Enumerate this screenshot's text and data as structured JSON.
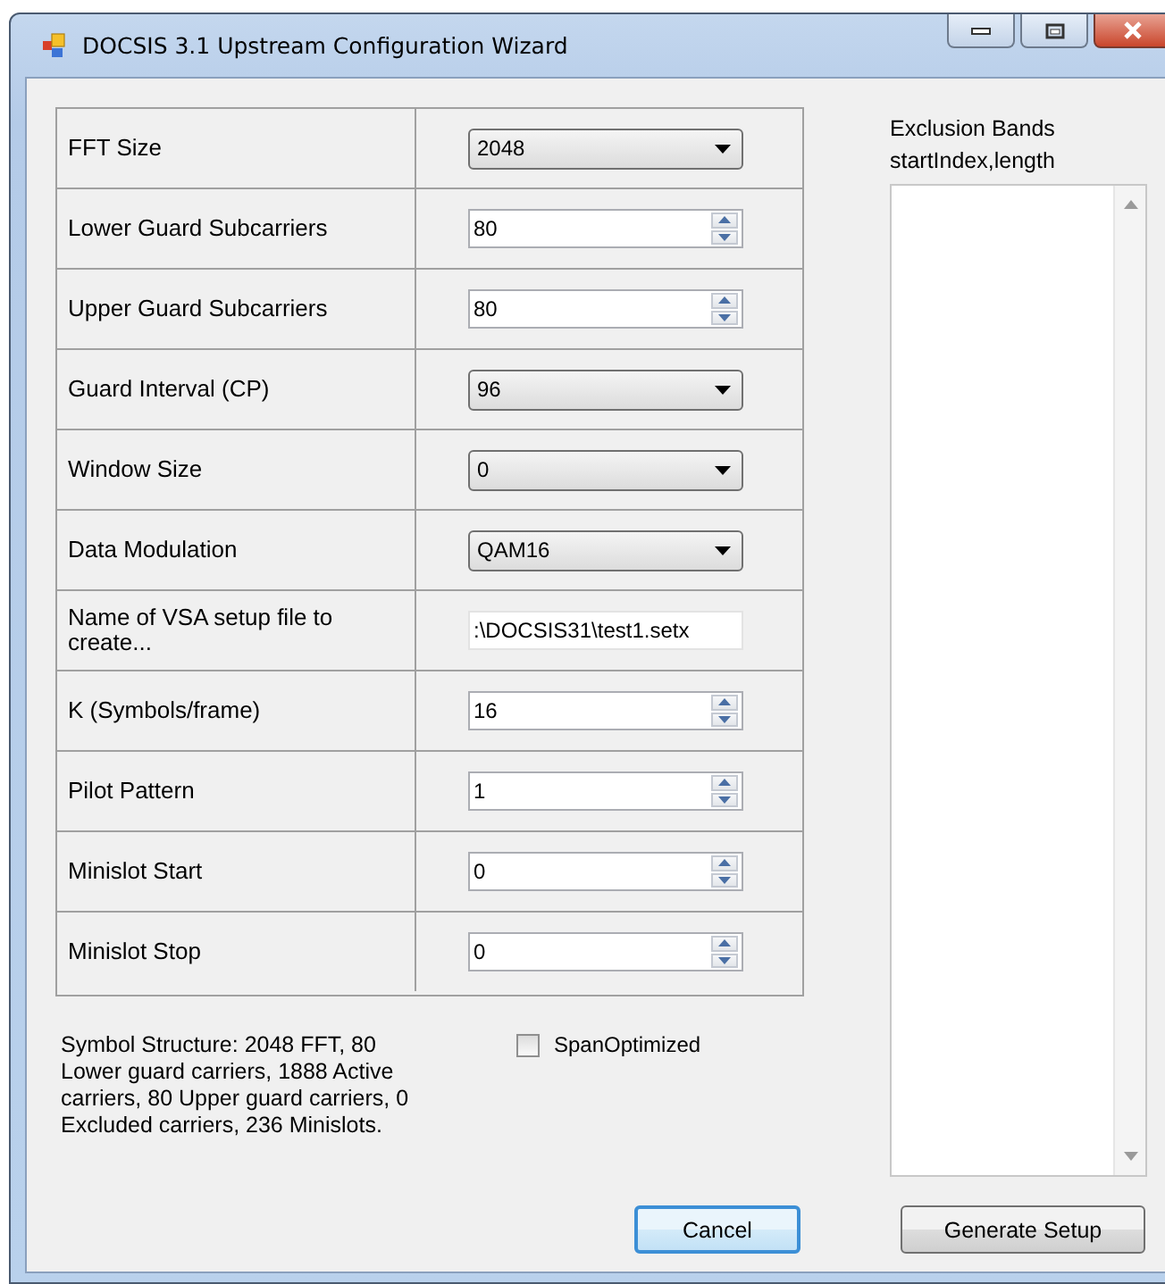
{
  "window": {
    "title": "DOCSIS 3.1 Upstream Configuration Wizard"
  },
  "fields": [
    {
      "label": "FFT Size",
      "kind": "dropdown",
      "value": "2048"
    },
    {
      "label": "Lower Guard Subcarriers",
      "kind": "spin",
      "value": "80"
    },
    {
      "label": "Upper Guard Subcarriers",
      "kind": "spin",
      "value": "80"
    },
    {
      "label": "Guard Interval (CP)",
      "kind": "dropdown",
      "value": "96"
    },
    {
      "label": "Window Size",
      "kind": "dropdown",
      "value": "0"
    },
    {
      "label": "Data Modulation",
      "kind": "dropdown",
      "value": "QAM16"
    },
    {
      "label": "Name of VSA setup file to create...",
      "kind": "text",
      "value": ":\\DOCSIS31\\test1.setx"
    },
    {
      "label": "K (Symbols/frame)",
      "kind": "spin",
      "value": "16"
    },
    {
      "label": "Pilot Pattern",
      "kind": "spin",
      "value": "1"
    },
    {
      "label": "Minislot Start",
      "kind": "spin",
      "value": "0"
    },
    {
      "label": "Minislot Stop",
      "kind": "spin",
      "value": "0"
    }
  ],
  "exclusion_bands": {
    "label": "Exclusion Bands startIndex,length"
  },
  "summary": "Symbol Structure: 2048 FFT, 80 Lower guard carriers, 1888 Active carriers, 80 Upper guard carriers, 0 Excluded carriers, 236 Minislots.",
  "span_optimized": {
    "label": "SpanOptimized",
    "checked": false
  },
  "buttons": [
    {
      "label": "Cancel",
      "focused": true
    },
    {
      "label": "Generate Setup",
      "focused": false
    }
  ]
}
